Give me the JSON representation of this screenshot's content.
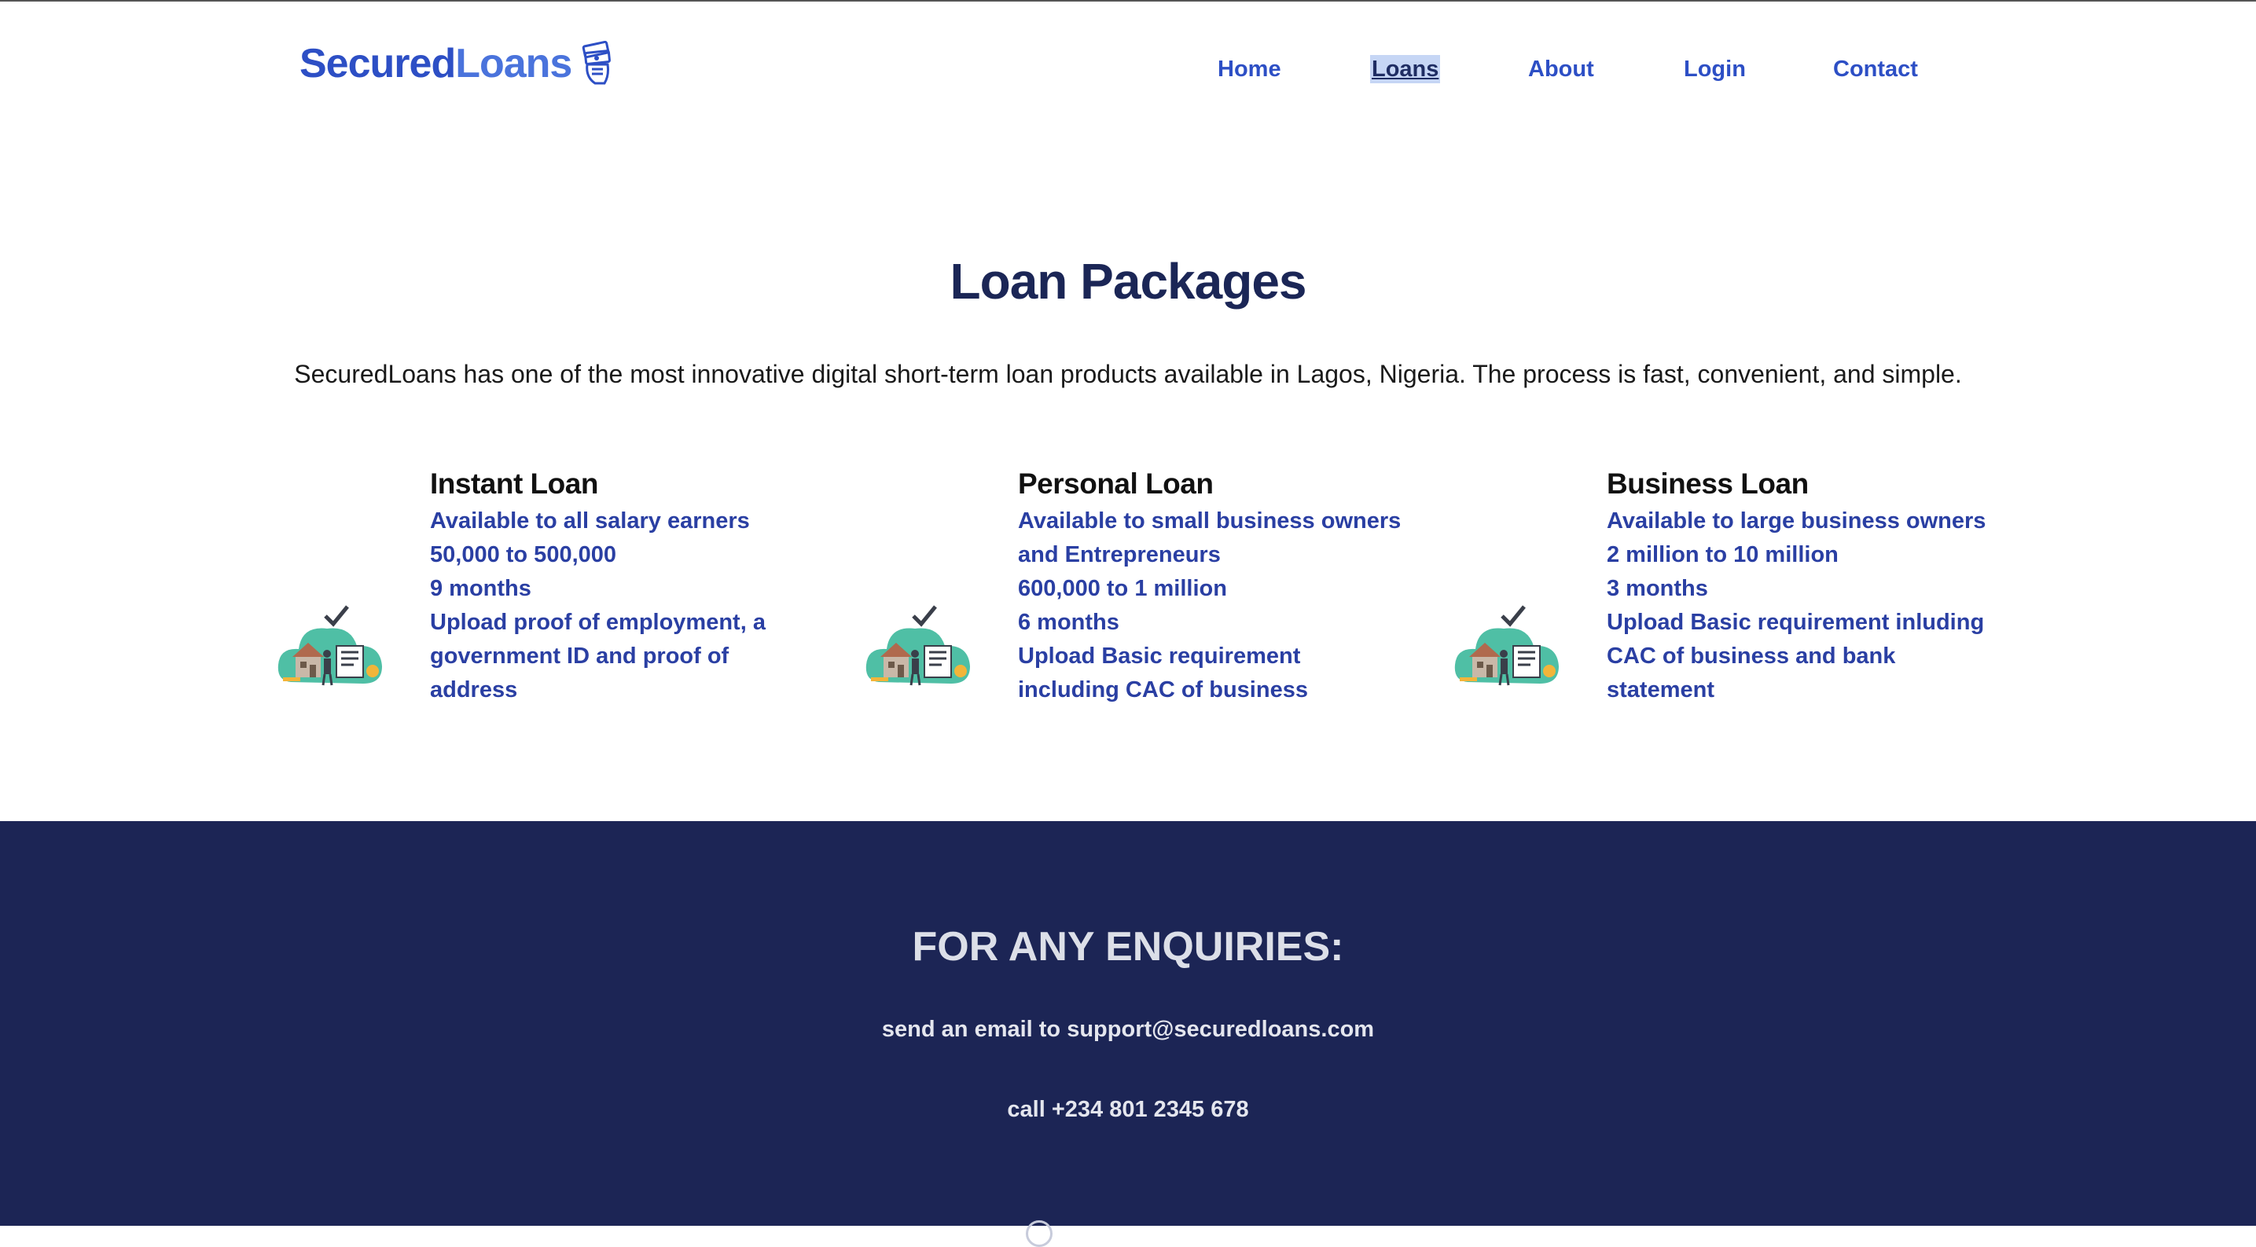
{
  "header": {
    "logo": {
      "part1": "Secured",
      "part2": "Loans",
      "icon": "money-stack-icon"
    },
    "nav": [
      {
        "label": "Home",
        "active": false
      },
      {
        "label": "Loans",
        "active": true
      },
      {
        "label": "About",
        "active": false
      },
      {
        "label": "Login",
        "active": false
      },
      {
        "label": "Contact",
        "active": false
      }
    ]
  },
  "main": {
    "title": "Loan Packages",
    "intro": "SecuredLoans has one of the most innovative digital short-term loan products available in Lagos, Nigeria. The process is fast, convenient, and simple.",
    "packages": [
      {
        "title": "Instant Loan",
        "icon": "loan-approval-illustration",
        "lines": [
          "Available to all salary earners",
          "50,000 to 500,000",
          "9 months",
          "Upload proof of employment, a",
          "government ID and proof of",
          "address"
        ]
      },
      {
        "title": "Personal Loan",
        "icon": "loan-approval-illustration",
        "lines": [
          "Available to small business owners",
          "and Entrepreneurs",
          "600,000 to 1 million",
          "6 months",
          "Upload Basic requirement",
          "including CAC of business"
        ]
      },
      {
        "title": "Business Loan",
        "icon": "loan-approval-illustration",
        "lines": [
          "Available to large business owners",
          "2 million to 10 million",
          "3 months",
          "Upload Basic requirement inluding",
          "CAC of business and bank",
          "statement"
        ]
      }
    ]
  },
  "footer": {
    "heading": "FOR ANY ENQUIRIES:",
    "email_line": "send an email to support@securedloans.com",
    "phone_line": "call +234 801 2345 678"
  },
  "colors": {
    "brand_blue": "#2d4fc5",
    "brand_light_blue": "#4a73dc",
    "text_blue": "#2a3fa3",
    "title_navy": "#1b2656",
    "footer_bg": "#1c2555",
    "illustration_teal": "#4fbfa5"
  }
}
